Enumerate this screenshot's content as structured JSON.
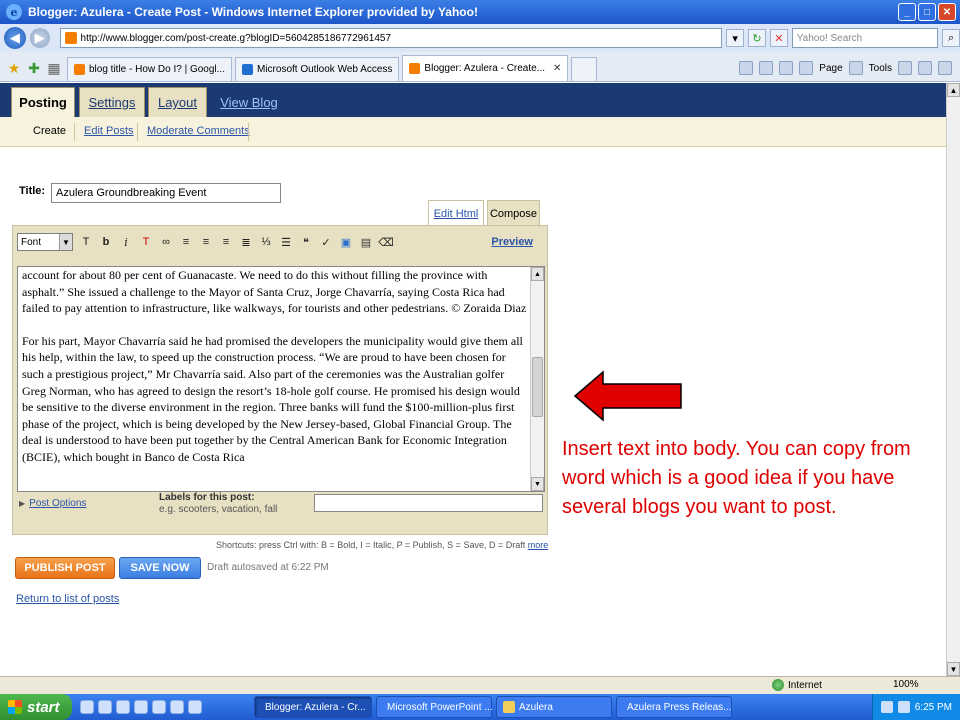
{
  "window": {
    "title": "Blogger: Azulera - Create Post - Windows Internet Explorer provided by Yahoo!"
  },
  "addressbar": {
    "url": "http://www.blogger.com/post-create.g?blogID=5604285186772961457",
    "search_placeholder": "Yahoo! Search"
  },
  "browser_tabs": [
    {
      "label": "blog title - How Do I? | Googl..."
    },
    {
      "label": "Microsoft Outlook Web Access"
    },
    {
      "label": "Blogger: Azulera - Create..."
    }
  ],
  "commandbar": {
    "page_label": "Page",
    "tools_label": "Tools"
  },
  "blogger": {
    "main_tabs": [
      {
        "label": "Posting"
      },
      {
        "label": "Settings"
      },
      {
        "label": "Layout"
      },
      {
        "label": "View Blog"
      }
    ],
    "sub_tabs": [
      {
        "label": "Create"
      },
      {
        "label": "Edit Posts"
      },
      {
        "label": "Moderate Comments"
      }
    ]
  },
  "post": {
    "title_label": "Title:",
    "title_value": "Azulera Groundbreaking Event",
    "edit_html_tab": "Edit Html",
    "compose_tab": "Compose",
    "font_select": "Font",
    "preview_label": "Preview",
    "body_paragraphs": [
      "account for about 80 per cent of Guanacaste. We need to do this without filling the province with asphalt.” She issued a challenge to the Mayor of Santa Cruz, Jorge Chavarría, saying Costa Rica had failed to pay attention to infrastructure, like walkways, for tourists and other pedestrians. © Zoraida Diaz",
      "For his part, Mayor Chavarría said he had promised the developers the municipality would give them all his help, within the law, to speed up the construction process. “We are proud to have been chosen for such a prestigious project,” Mr Chavarría said. Also part of the ceremonies was the Australian golfer Greg Norman, who has agreed to design the resort’s 18-hole golf course. He promised his design would be sensitive to the diverse environment in the region. Three banks will fund the $100-million-plus first phase of the project, which is being developed by the New Jersey-based, Global Financial Group. The deal is understood to have been put together by the Central American Bank for Economic Integration (BCIE), which bought in Banco de Costa Rica"
    ],
    "post_options_label": "Post Options",
    "labels_title": "Labels for this post:",
    "labels_hint": "e.g. scooters, vacation, fall",
    "labels_value": "",
    "shortcuts_text": "Shortcuts: press Ctrl with: B = Bold, I = Italic, P = Publish, S = Save, D = Draft",
    "shortcuts_more": "more",
    "publish_label": "PUBLISH POST",
    "save_label": "SAVE NOW",
    "autosave_text": "Draft autosaved at 6:22 PM",
    "return_label": "Return to list of posts"
  },
  "annotation": {
    "callout_text": "Insert text into body. You can copy from word which is a good idea if you have several blogs you want to post.",
    "arrow_color": "#e00000"
  },
  "statusbar": {
    "zone": "Internet",
    "zoom": "100%"
  },
  "taskbar": {
    "start_label": "start",
    "tasks": [
      {
        "label": "Blogger: Azulera - Cr..."
      },
      {
        "label": "Microsoft PowerPoint ..."
      },
      {
        "label": "Azulera"
      },
      {
        "label": "Azulera Press Releas..."
      }
    ],
    "clock": "6:25 PM"
  }
}
